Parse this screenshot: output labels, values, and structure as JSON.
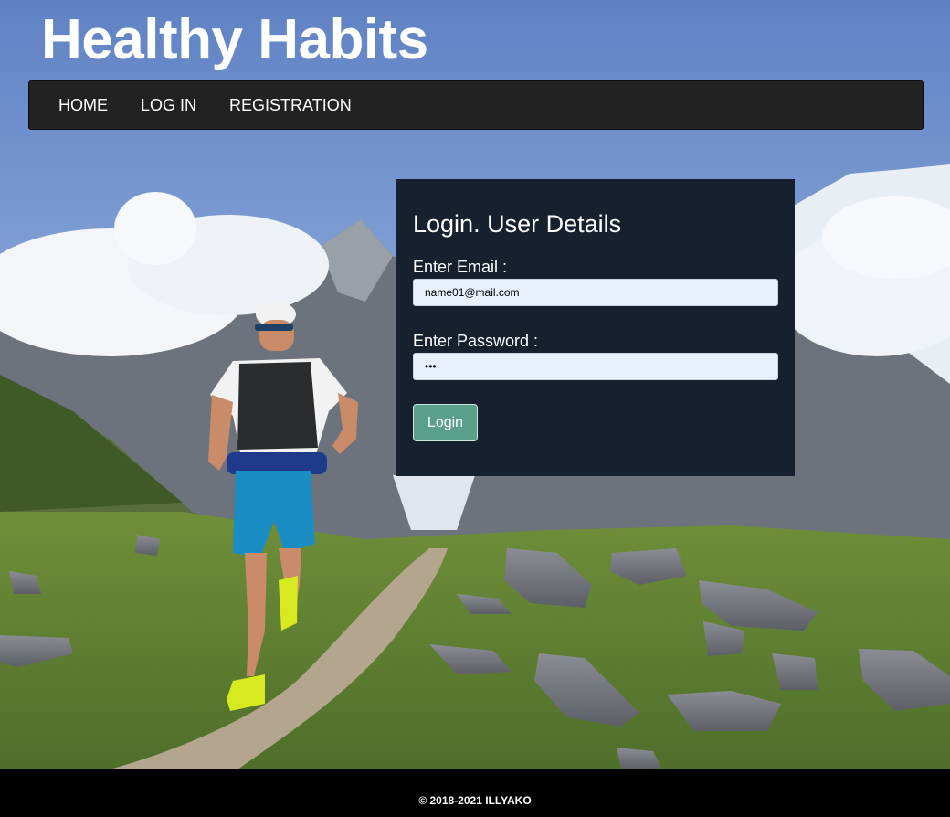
{
  "header": {
    "site_title": "Healthy Habits"
  },
  "nav": {
    "items": [
      {
        "label": "HOME"
      },
      {
        "label": "LOG IN"
      },
      {
        "label": "REGISTRATION"
      }
    ]
  },
  "login_form": {
    "title": "Login. User Details",
    "email_label": "Enter Email :",
    "email_value": "name01@mail.com",
    "password_label": "Enter Password :",
    "password_value": "abc",
    "submit_label": "Login"
  },
  "footer": {
    "copyright": "© 2018-2021 ILLYAKO"
  },
  "colors": {
    "navbar_bg": "#222222",
    "panel_bg": "#17202f",
    "button_bg": "#5a9e8c",
    "input_bg": "#e8f0fe",
    "footer_bg": "#000000"
  }
}
